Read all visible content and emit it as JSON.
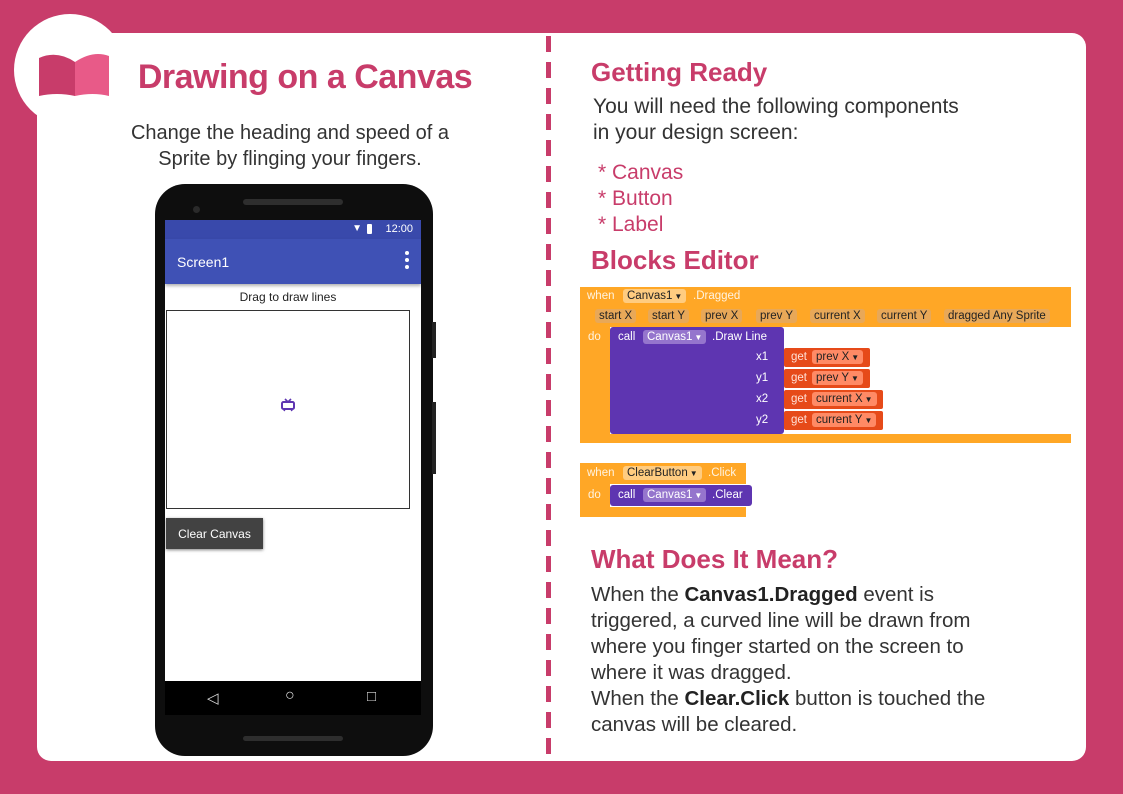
{
  "left": {
    "title": "Drawing on a Canvas",
    "subtitle_line1": "Change the heading and speed of a",
    "subtitle_line2": "Sprite by flinging your fingers."
  },
  "phone": {
    "time": "12:00",
    "app_title": "Screen1",
    "drag_label": "Drag to draw lines",
    "button_label": "Clear Canvas"
  },
  "getting_ready": {
    "heading": "Getting Ready",
    "line1": "You will need the following components",
    "line2": "in your design screen:",
    "items": [
      "* Canvas",
      "* Button",
      "* Label"
    ]
  },
  "blocks_editor": {
    "heading": "Blocks Editor",
    "dragged_event": {
      "when": "when",
      "component": "Canvas1",
      "event": ".Dragged",
      "params": [
        "start X",
        "start Y",
        "prev X",
        "prev Y",
        "current X",
        "current Y",
        "dragged Any Sprite"
      ],
      "do": "do",
      "call": "call",
      "call_component": "Canvas1",
      "method": ".Draw Line",
      "args": [
        {
          "name": "x1",
          "get": "get",
          "var": "prev X"
        },
        {
          "name": "y1",
          "get": "get",
          "var": "prev Y"
        },
        {
          "name": "x2",
          "get": "get",
          "var": "current X"
        },
        {
          "name": "y2",
          "get": "get",
          "var": "current Y"
        }
      ]
    },
    "click_event": {
      "when": "when",
      "component": "ClearButton",
      "event": ".Click",
      "do": "do",
      "call": "call",
      "call_component": "Canvas1",
      "method": ".Clear"
    }
  },
  "meaning": {
    "heading": "What Does It Mean?",
    "p1_pre": "When the ",
    "p1_bold": "Canvas1.Dragged",
    "p1_post": " event is triggered, a curved line will be drawn from where you finger started on the screen to where it was dragged.",
    "p2_pre": "When the ",
    "p2_bold": "Clear.Click",
    "p2_post": " button is touched the canvas will be cleared."
  },
  "colors": {
    "accent": "#c83c6a",
    "event_block": "#ffa726",
    "call_block": "#5e35b1",
    "getter_block": "#e64a19"
  }
}
